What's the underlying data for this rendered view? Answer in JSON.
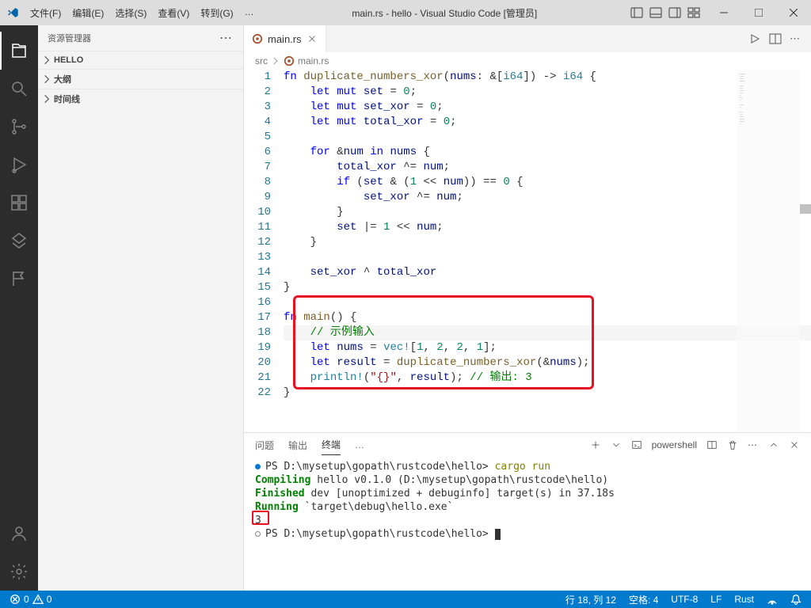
{
  "title": "main.rs - hello - Visual Studio Code [管理员]",
  "menu": [
    "文件(F)",
    "编辑(E)",
    "选择(S)",
    "查看(V)",
    "转到(G)",
    "…"
  ],
  "sidebar": {
    "title": "资源管理器",
    "sections": [
      "HELLO",
      "大纲",
      "时间线"
    ]
  },
  "tab": {
    "label": "main.rs"
  },
  "breadcrumb": {
    "folder": "src",
    "file": "main.rs"
  },
  "code": {
    "lines": [
      {
        "t": [
          [
            "kw-blue",
            "fn "
          ],
          [
            "fn-name",
            "duplicate_numbers_xor"
          ],
          [
            "",
            "("
          ],
          [
            "param",
            "nums"
          ],
          [
            "",
            ": &["
          ],
          [
            "type",
            "i64"
          ],
          [
            "",
            "]) -> "
          ],
          [
            "type",
            "i64"
          ],
          [
            "",
            " {"
          ]
        ]
      },
      {
        "t": [
          [
            "",
            "    "
          ],
          [
            "kw-blue",
            "let"
          ],
          [
            "",
            " "
          ],
          [
            "kw-blue",
            "mut"
          ],
          [
            "",
            " "
          ],
          [
            "param",
            "set"
          ],
          [
            "",
            " = "
          ],
          [
            "num",
            "0"
          ],
          [
            "",
            ";"
          ]
        ]
      },
      {
        "t": [
          [
            "",
            "    "
          ],
          [
            "kw-blue",
            "let"
          ],
          [
            "",
            " "
          ],
          [
            "kw-blue",
            "mut"
          ],
          [
            "",
            " "
          ],
          [
            "param",
            "set_xor"
          ],
          [
            "",
            " = "
          ],
          [
            "num",
            "0"
          ],
          [
            "",
            ";"
          ]
        ]
      },
      {
        "t": [
          [
            "",
            "    "
          ],
          [
            "kw-blue",
            "let"
          ],
          [
            "",
            " "
          ],
          [
            "kw-blue",
            "mut"
          ],
          [
            "",
            " "
          ],
          [
            "param",
            "total_xor"
          ],
          [
            "",
            " = "
          ],
          [
            "num",
            "0"
          ],
          [
            "",
            ";"
          ]
        ]
      },
      {
        "t": [
          [
            "",
            ""
          ]
        ]
      },
      {
        "t": [
          [
            "",
            "    "
          ],
          [
            "kw-blue",
            "for"
          ],
          [
            "",
            " &"
          ],
          [
            "param",
            "num"
          ],
          [
            "",
            " "
          ],
          [
            "kw-blue",
            "in"
          ],
          [
            "",
            " "
          ],
          [
            "param",
            "nums"
          ],
          [
            "",
            " {"
          ]
        ]
      },
      {
        "t": [
          [
            "",
            "        "
          ],
          [
            "param",
            "total_xor"
          ],
          [
            "",
            " ^= "
          ],
          [
            "param",
            "num"
          ],
          [
            "",
            ";"
          ]
        ]
      },
      {
        "t": [
          [
            "",
            "        "
          ],
          [
            "kw-blue",
            "if"
          ],
          [
            "",
            " ("
          ],
          [
            "param",
            "set"
          ],
          [
            "",
            " & ("
          ],
          [
            "num",
            "1"
          ],
          [
            "",
            " << "
          ],
          [
            "param",
            "num"
          ],
          [
            "",
            ")) == "
          ],
          [
            "num",
            "0"
          ],
          [
            "",
            " {"
          ]
        ]
      },
      {
        "t": [
          [
            "",
            "            "
          ],
          [
            "param",
            "set_xor"
          ],
          [
            "",
            " ^= "
          ],
          [
            "param",
            "num"
          ],
          [
            "",
            ";"
          ]
        ]
      },
      {
        "t": [
          [
            "",
            "        }"
          ]
        ]
      },
      {
        "t": [
          [
            "",
            "        "
          ],
          [
            "param",
            "set"
          ],
          [
            "",
            " |= "
          ],
          [
            "num",
            "1"
          ],
          [
            "",
            " << "
          ],
          [
            "param",
            "num"
          ],
          [
            "",
            ";"
          ]
        ]
      },
      {
        "t": [
          [
            "",
            "    }"
          ]
        ]
      },
      {
        "t": [
          [
            "",
            ""
          ]
        ]
      },
      {
        "t": [
          [
            "",
            "    "
          ],
          [
            "param",
            "set_xor"
          ],
          [
            "",
            " ^ "
          ],
          [
            "param",
            "total_xor"
          ]
        ]
      },
      {
        "t": [
          [
            "",
            "}"
          ]
        ]
      },
      {
        "t": [
          [
            "",
            ""
          ]
        ]
      },
      {
        "t": [
          [
            "kw-blue",
            "fn "
          ],
          [
            "fn-name",
            "main"
          ],
          [
            "",
            "() {"
          ]
        ]
      },
      {
        "t": [
          [
            "",
            "    "
          ],
          [
            "comment",
            "// 示例输入"
          ]
        ],
        "current": true
      },
      {
        "t": [
          [
            "",
            "    "
          ],
          [
            "kw-blue",
            "let"
          ],
          [
            "",
            " "
          ],
          [
            "param",
            "nums"
          ],
          [
            "",
            " = "
          ],
          [
            "macro",
            "vec!"
          ],
          [
            "",
            "["
          ],
          [
            "num",
            "1"
          ],
          [
            "",
            ", "
          ],
          [
            "num",
            "2"
          ],
          [
            "",
            ", "
          ],
          [
            "num",
            "2"
          ],
          [
            "",
            ", "
          ],
          [
            "num",
            "1"
          ],
          [
            "",
            "];"
          ]
        ]
      },
      {
        "t": [
          [
            "",
            "    "
          ],
          [
            "kw-blue",
            "let"
          ],
          [
            "",
            " "
          ],
          [
            "param",
            "result"
          ],
          [
            "",
            " = "
          ],
          [
            "fn-name",
            "duplicate_numbers_xor"
          ],
          [
            "",
            "(&"
          ],
          [
            "param",
            "nums"
          ],
          [
            "",
            ");"
          ]
        ]
      },
      {
        "t": [
          [
            "",
            "    "
          ],
          [
            "macro",
            "println!"
          ],
          [
            "",
            "("
          ],
          [
            "str",
            "\"{}\""
          ],
          [
            "",
            ", "
          ],
          [
            "param",
            "result"
          ],
          [
            "",
            "); "
          ],
          [
            "comment",
            "// 输出: 3"
          ]
        ]
      },
      {
        "t": [
          [
            "",
            "}"
          ]
        ]
      }
    ]
  },
  "panel": {
    "tabs": [
      "问题",
      "输出",
      "终端",
      "…"
    ],
    "active_tab": "终端",
    "shell": "powershell",
    "lines": [
      {
        "prefix": "dot",
        "parts": [
          [
            "",
            "PS D:\\mysetup\\gopath\\rustcode\\hello> "
          ],
          [
            "t-yellow",
            "cargo run"
          ]
        ]
      },
      {
        "prefix": "",
        "parts": [
          [
            "",
            "   "
          ],
          [
            "t-green",
            "Compiling"
          ],
          [
            "",
            " hello v0.1.0 (D:\\mysetup\\gopath\\rustcode\\hello)"
          ]
        ]
      },
      {
        "prefix": "",
        "parts": [
          [
            "",
            "    "
          ],
          [
            "t-green",
            "Finished"
          ],
          [
            "",
            " dev [unoptimized + debuginfo] target(s) in 37.18s"
          ]
        ]
      },
      {
        "prefix": "",
        "parts": [
          [
            "",
            "     "
          ],
          [
            "t-green",
            "Running"
          ],
          [
            "",
            " `target\\debug\\hello.exe`"
          ]
        ]
      },
      {
        "prefix": "",
        "parts": [
          [
            "",
            " 3"
          ]
        ]
      },
      {
        "prefix": "circle",
        "parts": [
          [
            "",
            "PS D:\\mysetup\\gopath\\rustcode\\hello> "
          ]
        ],
        "cursor": true
      }
    ]
  },
  "statusbar": {
    "errors": "0",
    "warnings": "0",
    "position": "行 18, 列 12",
    "spaces": "空格: 4",
    "encoding": "UTF-8",
    "eol": "LF",
    "lang": "Rust"
  }
}
